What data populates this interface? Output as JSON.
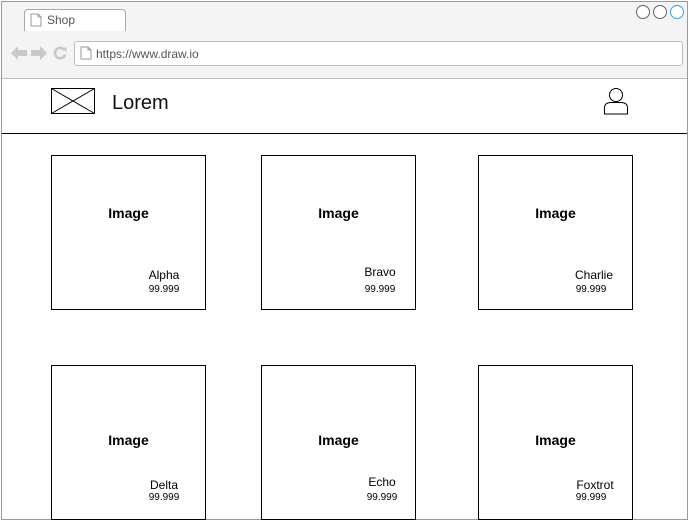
{
  "browser": {
    "tab_label": "Shop",
    "url": "https://www.draw.io"
  },
  "header": {
    "brand": "Lorem"
  },
  "colors": {
    "maximize_accent": "#29a8e0"
  },
  "products": [
    {
      "image_label": "Image",
      "name": "Alpha",
      "price": "99.999"
    },
    {
      "image_label": "Image",
      "name": "Bravo",
      "price": "99.999"
    },
    {
      "image_label": "Image",
      "name": "Charlie",
      "price": "99.999"
    },
    {
      "image_label": "Image",
      "name": "Delta",
      "price": "99.999"
    },
    {
      "image_label": "Image",
      "name": "Echo",
      "price": "99.999"
    },
    {
      "image_label": "Image",
      "name": "Foxtrot",
      "price": "99.999"
    }
  ]
}
